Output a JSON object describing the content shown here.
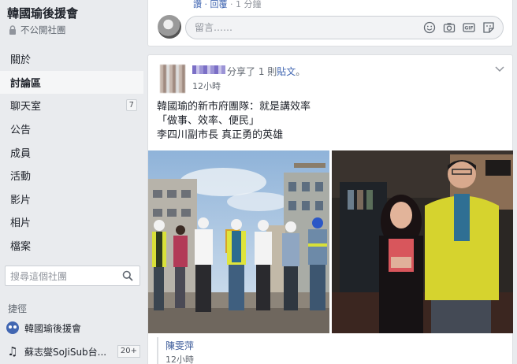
{
  "sidebar": {
    "group_name": "韓國瑜後援會",
    "privacy_label": "不公開社團",
    "nav_items": [
      {
        "label": "關於",
        "badge": ""
      },
      {
        "label": "討論區",
        "badge": ""
      },
      {
        "label": "聊天室",
        "badge": "7"
      },
      {
        "label": "公告",
        "badge": ""
      },
      {
        "label": "成員",
        "badge": ""
      },
      {
        "label": "活動",
        "badge": ""
      },
      {
        "label": "影片",
        "badge": ""
      },
      {
        "label": "相片",
        "badge": ""
      },
      {
        "label": "檔案",
        "badge": ""
      }
    ],
    "search_placeholder": "搜尋這個社團",
    "shortcuts_heading": "捷徑",
    "shortcuts": [
      {
        "label": "韓國瑜後援會",
        "badge": "",
        "icon": "group-icon"
      },
      {
        "label": "蘇志燮SoJiSub台...",
        "badge": "20+",
        "icon": "music-note-icon"
      }
    ]
  },
  "comment_box": {
    "prev_meta_prefix": "讚 · ",
    "prev_reply": "回覆",
    "prev_time": " · 1 分鐘",
    "placeholder": "留言……"
  },
  "post": {
    "share_verb": "分享了 1 則",
    "share_object": "貼文",
    "share_suffix": "。",
    "time": "12小時",
    "body_lines": [
      "韓國瑜的新市府團隊：就是講效率",
      "「做事、效率、便民」",
      "李四川副市長 真正勇的英雄"
    ],
    "original_author": "陳雯萍",
    "original_time": "12小時"
  },
  "colors": {
    "page_bg": "#e9ebee",
    "link": "#4267b2",
    "author_link": "#385898",
    "card_border": "#dddfe2"
  }
}
